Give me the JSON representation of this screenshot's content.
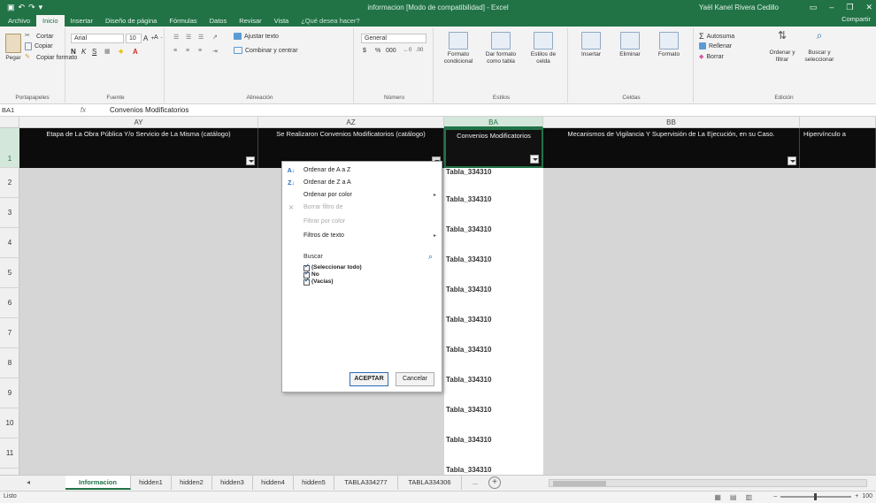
{
  "window": {
    "title": "informacion [Modo de compatibilidad] - Excel",
    "user": "Yaël Kanel Rivera Cedillo",
    "qat": [
      "save-icon",
      "undo-icon",
      "redo-icon",
      "customize-icon"
    ],
    "controls": [
      "ribbon-options-icon",
      "minimize-icon",
      "restore-icon",
      "close-icon"
    ]
  },
  "tabs": [
    {
      "label": "Archivo"
    },
    {
      "label": "Inicio"
    },
    {
      "label": "Insertar"
    },
    {
      "label": "Diseño de página"
    },
    {
      "label": "Fórmulas"
    },
    {
      "label": "Datos"
    },
    {
      "label": "Revisar"
    },
    {
      "label": "Vista"
    },
    {
      "label": "¿Qué desea hacer?"
    }
  ],
  "share": "Compartir",
  "ribbon": {
    "clipboard": {
      "paste": "Pegar",
      "cut": "Cortar",
      "copy": "Copiar",
      "format_painter": "Copiar formato",
      "label": "Portapapeles"
    },
    "font": {
      "name": "Arial",
      "size": "10",
      "bold": "N",
      "italic": "K",
      "underline": "S",
      "label": "Fuente"
    },
    "alignment": {
      "wrap": "Ajustar texto",
      "merge": "Combinar y centrar",
      "label": "Alineación"
    },
    "number": {
      "format": "General",
      "currency": "$",
      "percent": "%",
      "thousands": "000",
      "label": "Número"
    },
    "styles": {
      "conditional": "Formato condicional",
      "table": "Dar formato como tabla",
      "cell": "Estilos de celda",
      "label": "Estilos"
    },
    "cells": {
      "insert": "Insertar",
      "delete": "Eliminar",
      "format": "Formato",
      "label": "Celdas"
    },
    "editing": {
      "autosum": "Autosuma",
      "fill": "Rellenar",
      "clear": "Borrar",
      "sort": "Ordenar y filtrar",
      "find": "Buscar y seleccionar",
      "label": "Edición"
    }
  },
  "formula_bar": {
    "name_box": "BA1",
    "fx": "fx",
    "content": "Convenios Modificatorios"
  },
  "columns": [
    {
      "letter": "AY",
      "header": "Etapa de La Obra Pública Y/o Servicio de La Misma (catálogo)"
    },
    {
      "letter": "AZ",
      "header": "Se Realizaron Convenios Modificatorios (catálogo)"
    },
    {
      "letter": "BA",
      "header": "Convenios Modificatorios"
    },
    {
      "letter": "BB",
      "header": "Mecanismos de Vigilancia Y Supervisión de La Ejecución, en su Caso."
    },
    {
      "letter": "",
      "header": "Hipervínculo a"
    }
  ],
  "rows": [
    "1",
    "2",
    "3",
    "4",
    "5",
    "6",
    "7",
    "8",
    "9",
    "10",
    "11"
  ],
  "ba_values": [
    "Tabla_334310",
    "Tabla_334310",
    "Tabla_334310",
    "Tabla_334310",
    "Tabla_334310",
    "Tabla_334310",
    "Tabla_334310",
    "Tabla_334310",
    "Tabla_334310",
    "Tabla_334310",
    "Tabla_334310"
  ],
  "filter_menu": {
    "sort_az": "Ordenar de A a Z",
    "sort_za": "Ordenar de Z a A",
    "sort_color": "Ordenar por color",
    "clear_filter": "Borrar filtro de",
    "filter_color": "Filtrar por color",
    "text_filters": "Filtros de texto",
    "search": "Buscar",
    "options": [
      "(Seleccionar todo)",
      "No",
      "(Vacías)"
    ],
    "ok": "ACEPTAR",
    "cancel": "Cancelar"
  },
  "sheets": [
    "Informacion",
    "hidden1",
    "hidden2",
    "hidden3",
    "hidden4",
    "hidden5",
    "TABLA334277",
    "TABLA334306",
    "..."
  ],
  "status": {
    "text": "Listo",
    "zoom": "100"
  }
}
